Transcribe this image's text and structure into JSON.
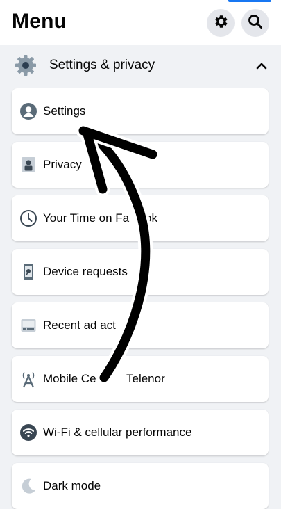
{
  "header": {
    "title": "Menu",
    "settings_icon": "gear-icon",
    "search_icon": "search-icon"
  },
  "section": {
    "label": "Settings & privacy",
    "icon": "gear-icon",
    "state_icon": "chevron-up-icon"
  },
  "items": [
    {
      "label": "Settings",
      "icon": "profile-icon"
    },
    {
      "label": "Privacy",
      "icon": "lock-icon"
    },
    {
      "label": "Your Time on Fa",
      "label_end": "ok",
      "icon": "clock-icon"
    },
    {
      "label": "Device requests",
      "icon": "phone-icon"
    },
    {
      "label": "Recent ad act",
      "icon": "ad-icon"
    },
    {
      "label": "Mobile Ce",
      "label_end": "Telenor",
      "icon": "antenna-icon"
    },
    {
      "label": "Wi-Fi & cellular performance",
      "icon": "wifi-icon"
    },
    {
      "label": "Dark mode",
      "icon": "moon-icon"
    }
  ],
  "colors": {
    "background": "#f0f2f5",
    "card": "#ffffff",
    "accent": "#1877f2",
    "arrow": "#000000"
  }
}
